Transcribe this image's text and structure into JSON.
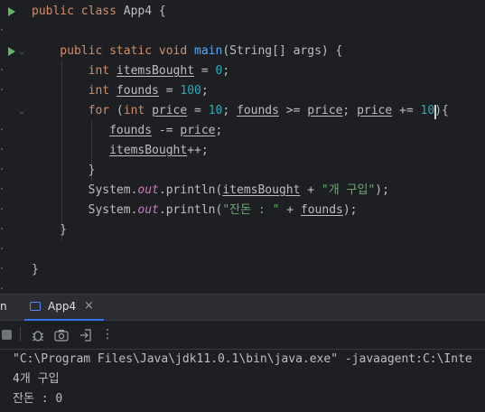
{
  "editor": {
    "lines": [
      {
        "parts": [
          {
            "t": "public class ",
            "c": "kw"
          },
          {
            "t": "App4 {",
            "c": ""
          }
        ]
      },
      {
        "parts": []
      },
      {
        "parts": [
          {
            "t": "    public static void ",
            "c": "kw"
          },
          {
            "t": "main",
            "c": "fn"
          },
          {
            "t": "(String[] args) {",
            "c": ""
          }
        ]
      },
      {
        "parts": [
          {
            "t": "        int ",
            "c": "kw"
          },
          {
            "t": "itemsBought",
            "c": "var"
          },
          {
            "t": " = ",
            "c": ""
          },
          {
            "t": "0",
            "c": "num"
          },
          {
            "t": ";",
            "c": ""
          }
        ]
      },
      {
        "parts": [
          {
            "t": "        int ",
            "c": "kw"
          },
          {
            "t": "founds",
            "c": "var"
          },
          {
            "t": " = ",
            "c": ""
          },
          {
            "t": "100",
            "c": "num"
          },
          {
            "t": ";",
            "c": ""
          }
        ]
      },
      {
        "parts": [
          {
            "t": "        for ",
            "c": "kw"
          },
          {
            "t": "(",
            "c": ""
          },
          {
            "t": "int ",
            "c": "kw"
          },
          {
            "t": "price",
            "c": "var"
          },
          {
            "t": " = ",
            "c": ""
          },
          {
            "t": "10",
            "c": "num"
          },
          {
            "t": "; ",
            "c": ""
          },
          {
            "t": "founds",
            "c": "var"
          },
          {
            "t": " >= ",
            "c": ""
          },
          {
            "t": "price",
            "c": "var"
          },
          {
            "t": "; ",
            "c": ""
          },
          {
            "t": "price",
            "c": "var"
          },
          {
            "t": " += ",
            "c": ""
          },
          {
            "t": "10",
            "c": "num"
          },
          {
            "t": "){",
            "c": ""
          }
        ]
      },
      {
        "parts": [
          {
            "t": "           ",
            "c": ""
          },
          {
            "t": "founds",
            "c": "var"
          },
          {
            "t": " -= ",
            "c": ""
          },
          {
            "t": "price",
            "c": "var"
          },
          {
            "t": ";",
            "c": ""
          }
        ]
      },
      {
        "parts": [
          {
            "t": "           ",
            "c": ""
          },
          {
            "t": "itemsBought",
            "c": "var"
          },
          {
            "t": "++;",
            "c": ""
          }
        ]
      },
      {
        "parts": [
          {
            "t": "        }",
            "c": ""
          }
        ]
      },
      {
        "parts": [
          {
            "t": "        System.",
            "c": ""
          },
          {
            "t": "out",
            "c": "field"
          },
          {
            "t": ".println(",
            "c": ""
          },
          {
            "t": "itemsBought",
            "c": "var"
          },
          {
            "t": " + ",
            "c": ""
          },
          {
            "t": "\"개 구입\"",
            "c": "str"
          },
          {
            "t": ");",
            "c": ""
          }
        ]
      },
      {
        "parts": [
          {
            "t": "        System.",
            "c": ""
          },
          {
            "t": "out",
            "c": "field"
          },
          {
            "t": ".println(",
            "c": ""
          },
          {
            "t": "\"잔돈 : \"",
            "c": "str"
          },
          {
            "t": " + ",
            "c": ""
          },
          {
            "t": "founds",
            "c": "var"
          },
          {
            "t": ");",
            "c": ""
          }
        ]
      },
      {
        "parts": [
          {
            "t": "    }",
            "c": ""
          }
        ]
      },
      {
        "parts": []
      },
      {
        "parts": [
          {
            "t": "}",
            "c": ""
          }
        ]
      }
    ]
  },
  "bottom_panel": {
    "cut_tab_label": "n",
    "tab_label": "App4",
    "close_glyph": "×",
    "more_glyph": "⋮"
  },
  "console": {
    "lines": [
      "\"C:\\Program Files\\Java\\jdk11.0.1\\bin\\java.exe\" -javaagent:C:\\Inte",
      "4개 구입",
      "잔돈 : 0"
    ]
  }
}
